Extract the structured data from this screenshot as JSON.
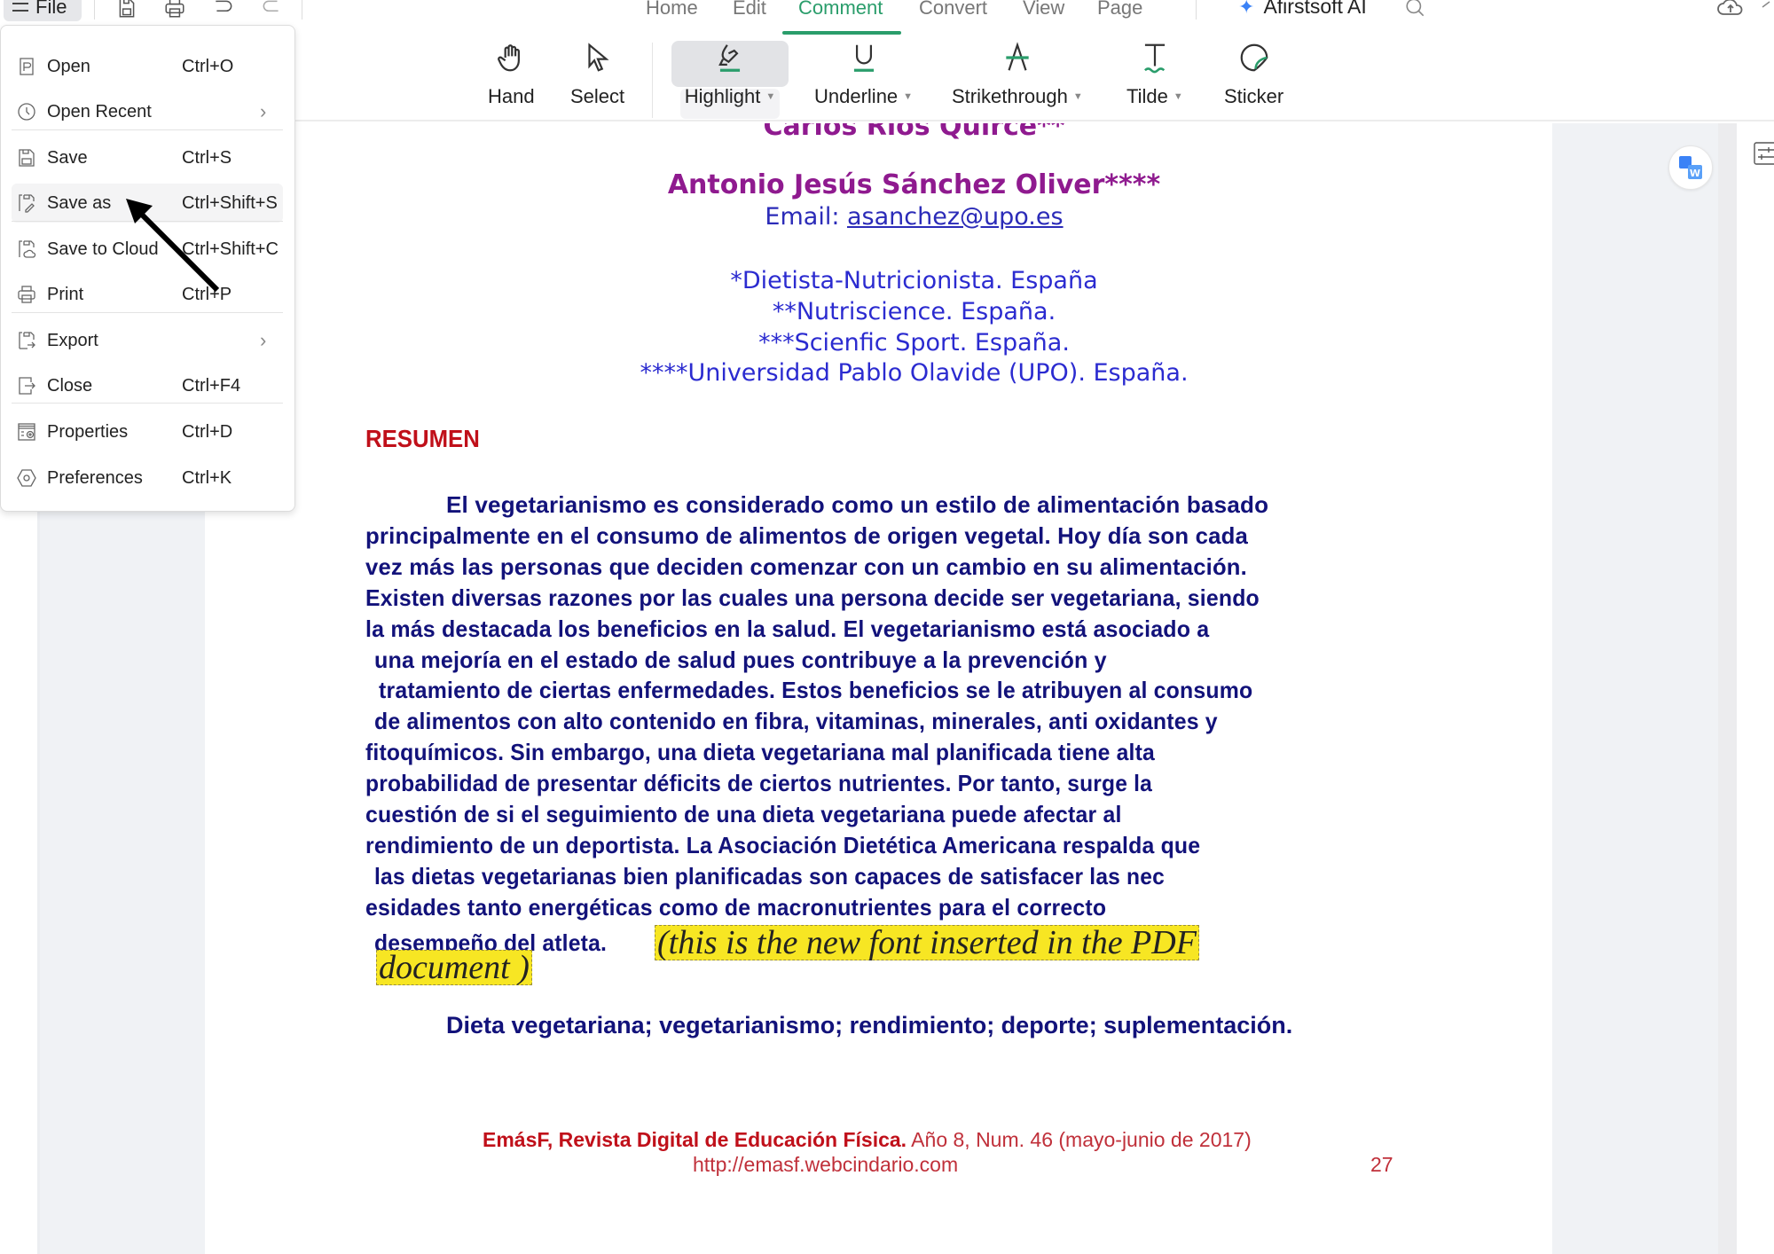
{
  "topbar": {
    "file_label": "File",
    "quick_actions": [
      "save-icon",
      "print-icon",
      "undo-icon",
      "redo-icon"
    ],
    "tabs": [
      {
        "label": "Home",
        "active": false
      },
      {
        "label": "Edit",
        "active": false
      },
      {
        "label": "Comment",
        "active": true
      },
      {
        "label": "Convert",
        "active": false
      },
      {
        "label": "View",
        "active": false
      },
      {
        "label": "Page",
        "active": false
      }
    ],
    "ai_label": "Afirstsoft AI",
    "accent_color": "#2a9d6b"
  },
  "toolbar": {
    "tools": [
      {
        "label": "Hand",
        "icon": "hand-icon",
        "dropdown": false
      },
      {
        "label": "Select",
        "icon": "cursor-icon",
        "dropdown": false
      },
      {
        "label": "Highlight",
        "icon": "highlighter-icon",
        "dropdown": true,
        "active": true
      },
      {
        "label": "Underline",
        "icon": "underline-icon",
        "dropdown": true
      },
      {
        "label": "Strikethrough",
        "icon": "strikethrough-icon",
        "dropdown": true
      },
      {
        "label": "Tilde",
        "icon": "tilde-icon",
        "dropdown": true
      },
      {
        "label": "Sticker",
        "icon": "sticker-icon",
        "dropdown": false
      }
    ]
  },
  "file_menu": {
    "items": [
      {
        "label": "Open",
        "shortcut": "Ctrl+O",
        "icon": "open-file-icon"
      },
      {
        "label": "Open Recent",
        "shortcut": "",
        "icon": "clock-icon",
        "submenu": true
      },
      {
        "label": "Save",
        "shortcut": "Ctrl+S",
        "icon": "save-icon"
      },
      {
        "label": "Save as",
        "shortcut": "Ctrl+Shift+S",
        "icon": "save-as-icon",
        "hovered": true
      },
      {
        "label": "Save to Cloud",
        "shortcut": "Ctrl+Shift+C",
        "icon": "save-cloud-icon"
      },
      {
        "label": "Print",
        "shortcut": "Ctrl+P",
        "icon": "print-icon"
      },
      {
        "label": "Export",
        "shortcut": "",
        "icon": "export-icon",
        "submenu": true
      },
      {
        "label": "Close",
        "shortcut": "Ctrl+F4",
        "icon": "close-file-icon"
      },
      {
        "label": "Properties",
        "shortcut": "Ctrl+D",
        "icon": "properties-icon"
      },
      {
        "label": "Preferences",
        "shortcut": "Ctrl+K",
        "icon": "preferences-icon"
      }
    ]
  },
  "document": {
    "author_cut": "Carlos Ríos Quirce**",
    "author": "Antonio Jesús Sánchez Oliver****",
    "email_label": "Email: ",
    "email": "asanchez@upo.es",
    "affiliations": [
      "*Dietista-Nutricionista. España",
      "**Nutriscience. España.",
      "***Scienfic Sport. España.",
      "****Universidad Pablo Olavide (UPO). España."
    ],
    "section_title": "RESUMEN",
    "body_lines": [
      "El vegetarianismo es considerado como un estilo de alimentación basado",
      "principalmente en el consumo de alimentos de origen vegetal. Hoy día son cada",
      "vez más las personas que deciden comenzar con un cambio en su alimentación.",
      "Existen diversas razones por las cuales una persona decide ser vegetariana,  siendo",
      "la más destacada los beneficios en la salud. El vegetarianismo está  asociado a",
      "una mejoría en el estado de salud pues contribuye a la prevención  y",
      "tratamiento de ciertas enfermedades. Estos beneficios se le atribuyen al  consumo",
      "de alimentos con alto  contenido  en  fibra,  vitaminas,  minerales,  anti  oxidantes y",
      "fitoquímicos.  Sin embargo,  una  dieta  vegetariana  mal  planificada  tiene  alta",
      "probabilidad  de presentar  déficits  de  ciertos  nutrientes.  Por  tanto,  surge  la",
      "cuestión  de  si  el seguimiento  de  una  dieta  vegetariana  puede  afectar  al",
      "rendimiento  de  un deportista.  La Asociación Dietética  Americana  respalda que",
      "las dietas vegetarianas bien  planificadas  son  capaces  de  satisfacer   las  nec",
      "esidades  tanto  energéticas como de macronutrientes para el  correcto",
      "desempeño del atleta. "
    ],
    "inserted_text_line1": "(this is the new  font inserted in   the  PDF",
    "inserted_text_line2": "document    )",
    "highlight_color": "#f7e623",
    "keywords": "Dieta vegetariana; vegetarianismo; rendimiento; deporte; suplementación.",
    "footer_bold": "EmásF, Revista Digital de Educación Física.",
    "footer_rest": " Año 8, Num. 46 (mayo-junio de 2017)",
    "footer_url": "http://emasf.webcindario.com",
    "page_number": "27"
  }
}
